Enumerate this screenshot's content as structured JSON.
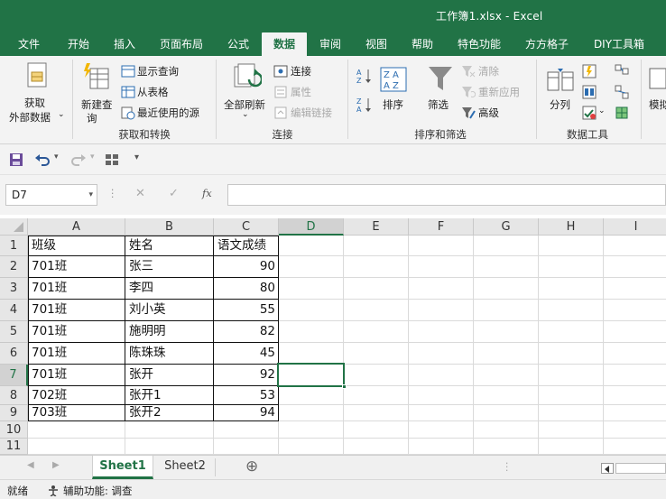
{
  "window": {
    "title": "工作簿1.xlsx  -  Excel"
  },
  "ribbon_tabs": [
    {
      "label": "文件"
    },
    {
      "label": "开始"
    },
    {
      "label": "插入"
    },
    {
      "label": "页面布局"
    },
    {
      "label": "公式"
    },
    {
      "label": "数据",
      "active": true
    },
    {
      "label": "审阅"
    },
    {
      "label": "视图"
    },
    {
      "label": "帮助"
    },
    {
      "label": "特色功能"
    },
    {
      "label": "方方格子"
    },
    {
      "label": "DIY工具箱"
    }
  ],
  "ribbon": {
    "get_external_1": "获取",
    "get_external_2": "外部数据",
    "new_query_1": "新建查",
    "new_query_2": "询",
    "show_queries": "显示查询",
    "from_table": "从表格",
    "recent_sources": "最近使用的源",
    "group_get_transform": "获取和转换",
    "refresh_all": "全部刷新",
    "connections": "连接",
    "properties": "属性",
    "edit_links": "编辑链接",
    "group_connections": "连接",
    "sort": "排序",
    "filter": "筛选",
    "clear": "清除",
    "reapply": "重新应用",
    "advanced": "高级",
    "group_sort_filter": "排序和筛选",
    "text_to_columns": "分列",
    "group_data_tools": "数据工具",
    "whatif_partial": "模拟"
  },
  "qat": {
    "more": "▾"
  },
  "formula_bar": {
    "name_box": "D7",
    "fx": "fx",
    "formula": ""
  },
  "columns": [
    "A",
    "B",
    "C",
    "D",
    "E",
    "F",
    "G",
    "H",
    "I"
  ],
  "selected_column": "D",
  "rows": [
    "1",
    "2",
    "3",
    "4",
    "5",
    "6",
    "7",
    "8",
    "9",
    "10",
    "11"
  ],
  "selected_row": "7",
  "table": {
    "headers": [
      "班级",
      "姓名",
      "语文成绩"
    ],
    "records": [
      [
        "701班",
        "张三",
        "90"
      ],
      [
        "701班",
        "李四",
        "80"
      ],
      [
        "701班",
        "刘小英",
        "55"
      ],
      [
        "701班",
        "施明明",
        "82"
      ],
      [
        "701班",
        "陈珠珠",
        "45"
      ],
      [
        "701班",
        "张开",
        "92"
      ],
      [
        "702班",
        "张开1",
        "53"
      ],
      [
        "703班",
        "张开2",
        "94"
      ]
    ]
  },
  "sheets": [
    {
      "name": "Sheet1",
      "active": true
    },
    {
      "name": "Sheet2"
    }
  ],
  "add_sheet": "⊕",
  "status": {
    "ready": "就绪",
    "accessibility": "辅助功能: 调查"
  },
  "colors": {
    "excel_green": "#217346"
  }
}
